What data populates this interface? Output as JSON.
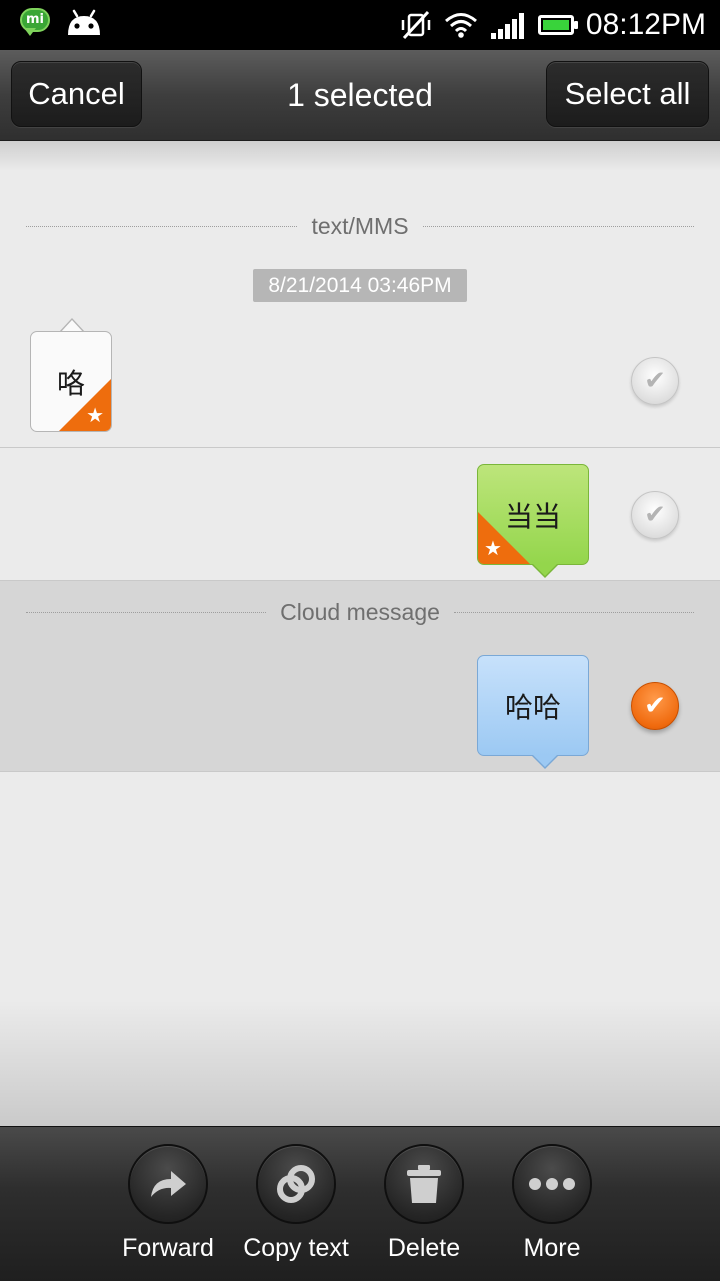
{
  "status_bar": {
    "time": "08:12PM",
    "left_icons": [
      "mi-talk-icon",
      "android-icon"
    ],
    "right_icons": [
      "vibrate-off-icon",
      "wifi-icon",
      "signal-icon",
      "battery-icon"
    ],
    "mi_label": "mi"
  },
  "action_bar": {
    "cancel_label": "Cancel",
    "title": "1 selected",
    "select_all_label": "Select all"
  },
  "sections": [
    {
      "label": "text/MMS"
    },
    {
      "label": "Cloud message"
    }
  ],
  "date_stamp": "8/21/2014 03:46PM",
  "messages": [
    {
      "text": "咯",
      "direction": "incoming",
      "starred": true,
      "selected": false,
      "color": "#fafafa"
    },
    {
      "text": "当当",
      "direction": "outgoing",
      "starred": true,
      "selected": false,
      "color": "#a6dd5e"
    },
    {
      "text": "哈哈",
      "direction": "outgoing",
      "starred": false,
      "selected": true,
      "color": "#a9d2f6"
    }
  ],
  "toolbar": {
    "items": [
      {
        "label": "Forward",
        "icon": "forward-arrow-icon"
      },
      {
        "label": "Copy text",
        "icon": "copy-rings-icon"
      },
      {
        "label": "Delete",
        "icon": "trash-icon"
      },
      {
        "label": "More",
        "icon": "more-dots-icon"
      }
    ]
  },
  "colors": {
    "accent": "#f06b0f",
    "star_corner": "#ee6d0d"
  }
}
